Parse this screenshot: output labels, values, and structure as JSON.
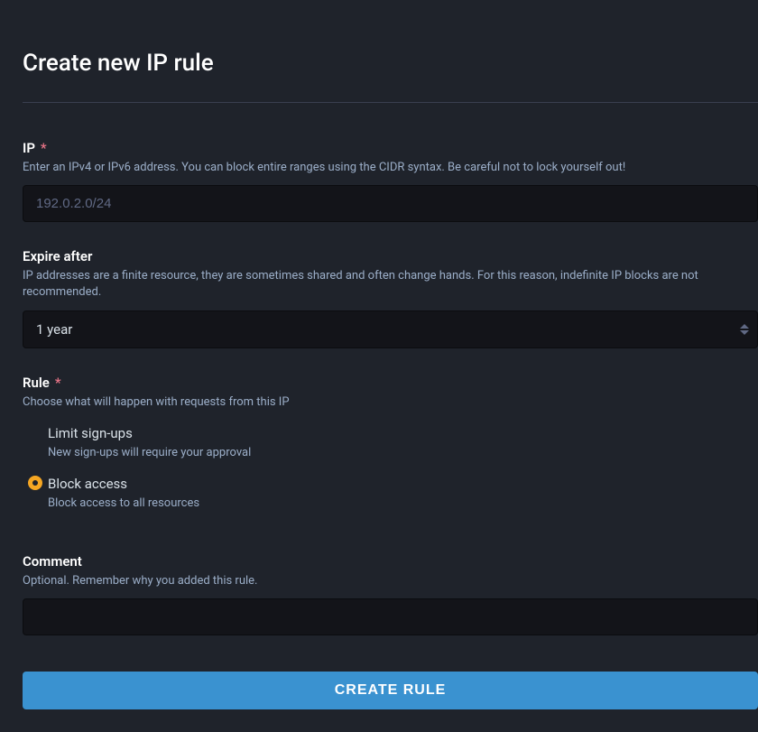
{
  "page": {
    "title": "Create new IP rule"
  },
  "fields": {
    "ip": {
      "label": "IP",
      "required_mark": "*",
      "hint": "Enter an IPv4 or IPv6 address. You can block entire ranges using the CIDR syntax. Be careful not to lock yourself out!",
      "placeholder": "192.0.2.0/24",
      "value": ""
    },
    "expire": {
      "label": "Expire after",
      "hint": "IP addresses are a finite resource, they are sometimes shared and often change hands. For this reason, indefinite IP blocks are not recommended.",
      "selected": "1 year"
    },
    "rule": {
      "label": "Rule",
      "required_mark": "*",
      "hint": "Choose what will happen with requests from this IP",
      "options": [
        {
          "label": "Limit sign-ups",
          "hint": "New sign-ups will require your approval",
          "selected": false
        },
        {
          "label": "Block access",
          "hint": "Block access to all resources",
          "selected": true
        }
      ]
    },
    "comment": {
      "label": "Comment",
      "hint": "Optional. Remember why you added this rule.",
      "value": ""
    }
  },
  "actions": {
    "submit": "CREATE RULE"
  }
}
